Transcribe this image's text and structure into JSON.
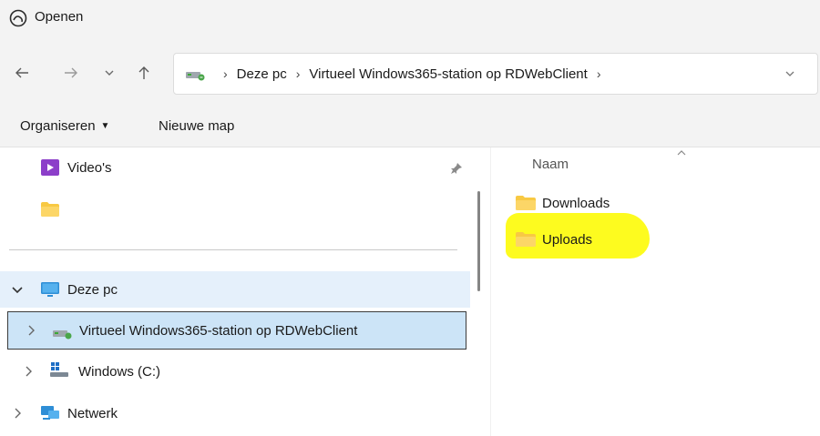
{
  "window": {
    "title": "Openen"
  },
  "navigation": {
    "back_icon": "arrow-left-icon",
    "forward_icon": "arrow-right-icon",
    "recent_icon": "chevron-down-icon",
    "up_icon": "arrow-up-icon"
  },
  "address": {
    "breadcrumbs": [
      "Deze pc",
      "Virtueel Windows365-station op RDWebClient"
    ],
    "separator": "›"
  },
  "commandbar": {
    "organize_label": "Organiseren",
    "new_folder_label": "Nieuwe map"
  },
  "navpane": {
    "items": [
      {
        "label": "Video's",
        "icon": "video-folder-icon"
      },
      {
        "label": "",
        "icon": "folder-icon"
      },
      {
        "label": "Deze pc",
        "icon": "monitor-icon"
      },
      {
        "label": "Virtueel Windows365-station op RDWebClient",
        "icon": "network-drive-icon"
      },
      {
        "label": "Windows (C:)",
        "icon": "windows-drive-icon"
      },
      {
        "label": "Netwerk",
        "icon": "network-icon"
      }
    ]
  },
  "filepane": {
    "column_name": "Naam",
    "items": [
      {
        "label": "Downloads",
        "icon": "folder-icon"
      },
      {
        "label": "Uploads",
        "icon": "folder-icon",
        "highlighted": true
      }
    ]
  },
  "colors": {
    "folder": "#f8c943",
    "selection": "#cce4f7",
    "highlight": "#fdfb1f",
    "chrome": "#f3f3f3"
  }
}
